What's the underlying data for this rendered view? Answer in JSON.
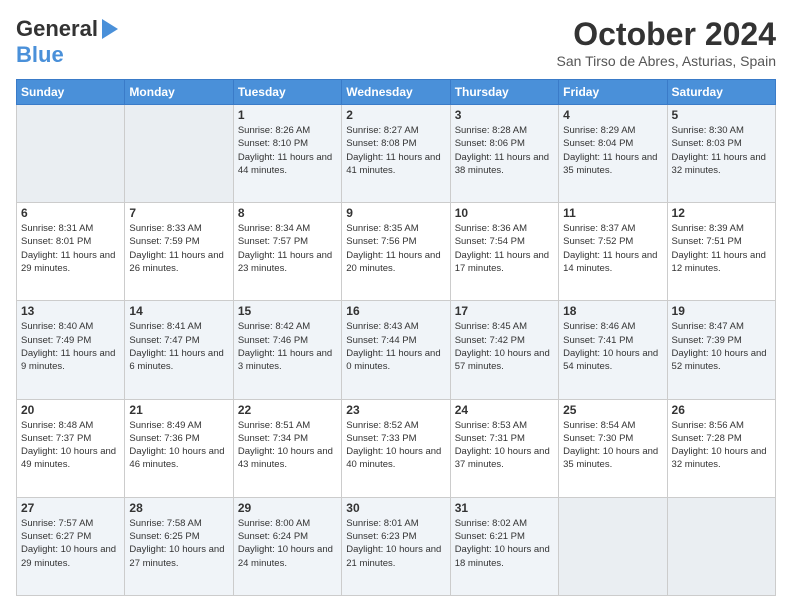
{
  "logo": {
    "line1": "General",
    "line2": "Blue"
  },
  "header": {
    "month": "October 2024",
    "location": "San Tirso de Abres, Asturias, Spain"
  },
  "days_of_week": [
    "Sunday",
    "Monday",
    "Tuesday",
    "Wednesday",
    "Thursday",
    "Friday",
    "Saturday"
  ],
  "weeks": [
    [
      {
        "day": "",
        "sunrise": "",
        "sunset": "",
        "daylight": ""
      },
      {
        "day": "",
        "sunrise": "",
        "sunset": "",
        "daylight": ""
      },
      {
        "day": "1",
        "sunrise": "Sunrise: 8:26 AM",
        "sunset": "Sunset: 8:10 PM",
        "daylight": "Daylight: 11 hours and 44 minutes."
      },
      {
        "day": "2",
        "sunrise": "Sunrise: 8:27 AM",
        "sunset": "Sunset: 8:08 PM",
        "daylight": "Daylight: 11 hours and 41 minutes."
      },
      {
        "day": "3",
        "sunrise": "Sunrise: 8:28 AM",
        "sunset": "Sunset: 8:06 PM",
        "daylight": "Daylight: 11 hours and 38 minutes."
      },
      {
        "day": "4",
        "sunrise": "Sunrise: 8:29 AM",
        "sunset": "Sunset: 8:04 PM",
        "daylight": "Daylight: 11 hours and 35 minutes."
      },
      {
        "day": "5",
        "sunrise": "Sunrise: 8:30 AM",
        "sunset": "Sunset: 8:03 PM",
        "daylight": "Daylight: 11 hours and 32 minutes."
      }
    ],
    [
      {
        "day": "6",
        "sunrise": "Sunrise: 8:31 AM",
        "sunset": "Sunset: 8:01 PM",
        "daylight": "Daylight: 11 hours and 29 minutes."
      },
      {
        "day": "7",
        "sunrise": "Sunrise: 8:33 AM",
        "sunset": "Sunset: 7:59 PM",
        "daylight": "Daylight: 11 hours and 26 minutes."
      },
      {
        "day": "8",
        "sunrise": "Sunrise: 8:34 AM",
        "sunset": "Sunset: 7:57 PM",
        "daylight": "Daylight: 11 hours and 23 minutes."
      },
      {
        "day": "9",
        "sunrise": "Sunrise: 8:35 AM",
        "sunset": "Sunset: 7:56 PM",
        "daylight": "Daylight: 11 hours and 20 minutes."
      },
      {
        "day": "10",
        "sunrise": "Sunrise: 8:36 AM",
        "sunset": "Sunset: 7:54 PM",
        "daylight": "Daylight: 11 hours and 17 minutes."
      },
      {
        "day": "11",
        "sunrise": "Sunrise: 8:37 AM",
        "sunset": "Sunset: 7:52 PM",
        "daylight": "Daylight: 11 hours and 14 minutes."
      },
      {
        "day": "12",
        "sunrise": "Sunrise: 8:39 AM",
        "sunset": "Sunset: 7:51 PM",
        "daylight": "Daylight: 11 hours and 12 minutes."
      }
    ],
    [
      {
        "day": "13",
        "sunrise": "Sunrise: 8:40 AM",
        "sunset": "Sunset: 7:49 PM",
        "daylight": "Daylight: 11 hours and 9 minutes."
      },
      {
        "day": "14",
        "sunrise": "Sunrise: 8:41 AM",
        "sunset": "Sunset: 7:47 PM",
        "daylight": "Daylight: 11 hours and 6 minutes."
      },
      {
        "day": "15",
        "sunrise": "Sunrise: 8:42 AM",
        "sunset": "Sunset: 7:46 PM",
        "daylight": "Daylight: 11 hours and 3 minutes."
      },
      {
        "day": "16",
        "sunrise": "Sunrise: 8:43 AM",
        "sunset": "Sunset: 7:44 PM",
        "daylight": "Daylight: 11 hours and 0 minutes."
      },
      {
        "day": "17",
        "sunrise": "Sunrise: 8:45 AM",
        "sunset": "Sunset: 7:42 PM",
        "daylight": "Daylight: 10 hours and 57 minutes."
      },
      {
        "day": "18",
        "sunrise": "Sunrise: 8:46 AM",
        "sunset": "Sunset: 7:41 PM",
        "daylight": "Daylight: 10 hours and 54 minutes."
      },
      {
        "day": "19",
        "sunrise": "Sunrise: 8:47 AM",
        "sunset": "Sunset: 7:39 PM",
        "daylight": "Daylight: 10 hours and 52 minutes."
      }
    ],
    [
      {
        "day": "20",
        "sunrise": "Sunrise: 8:48 AM",
        "sunset": "Sunset: 7:37 PM",
        "daylight": "Daylight: 10 hours and 49 minutes."
      },
      {
        "day": "21",
        "sunrise": "Sunrise: 8:49 AM",
        "sunset": "Sunset: 7:36 PM",
        "daylight": "Daylight: 10 hours and 46 minutes."
      },
      {
        "day": "22",
        "sunrise": "Sunrise: 8:51 AM",
        "sunset": "Sunset: 7:34 PM",
        "daylight": "Daylight: 10 hours and 43 minutes."
      },
      {
        "day": "23",
        "sunrise": "Sunrise: 8:52 AM",
        "sunset": "Sunset: 7:33 PM",
        "daylight": "Daylight: 10 hours and 40 minutes."
      },
      {
        "day": "24",
        "sunrise": "Sunrise: 8:53 AM",
        "sunset": "Sunset: 7:31 PM",
        "daylight": "Daylight: 10 hours and 37 minutes."
      },
      {
        "day": "25",
        "sunrise": "Sunrise: 8:54 AM",
        "sunset": "Sunset: 7:30 PM",
        "daylight": "Daylight: 10 hours and 35 minutes."
      },
      {
        "day": "26",
        "sunrise": "Sunrise: 8:56 AM",
        "sunset": "Sunset: 7:28 PM",
        "daylight": "Daylight: 10 hours and 32 minutes."
      }
    ],
    [
      {
        "day": "27",
        "sunrise": "Sunrise: 7:57 AM",
        "sunset": "Sunset: 6:27 PM",
        "daylight": "Daylight: 10 hours and 29 minutes."
      },
      {
        "day": "28",
        "sunrise": "Sunrise: 7:58 AM",
        "sunset": "Sunset: 6:25 PM",
        "daylight": "Daylight: 10 hours and 27 minutes."
      },
      {
        "day": "29",
        "sunrise": "Sunrise: 8:00 AM",
        "sunset": "Sunset: 6:24 PM",
        "daylight": "Daylight: 10 hours and 24 minutes."
      },
      {
        "day": "30",
        "sunrise": "Sunrise: 8:01 AM",
        "sunset": "Sunset: 6:23 PM",
        "daylight": "Daylight: 10 hours and 21 minutes."
      },
      {
        "day": "31",
        "sunrise": "Sunrise: 8:02 AM",
        "sunset": "Sunset: 6:21 PM",
        "daylight": "Daylight: 10 hours and 18 minutes."
      },
      {
        "day": "",
        "sunrise": "",
        "sunset": "",
        "daylight": ""
      },
      {
        "day": "",
        "sunrise": "",
        "sunset": "",
        "daylight": ""
      }
    ]
  ]
}
